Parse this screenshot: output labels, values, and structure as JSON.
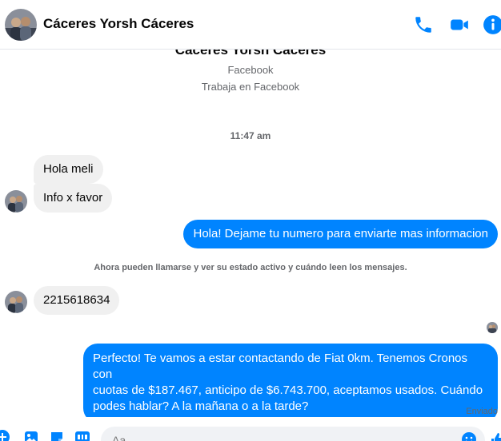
{
  "header": {
    "contact_name": "Cáceres Yorsh Cáceres",
    "icons": [
      "phone-icon",
      "video-icon",
      "info-icon"
    ]
  },
  "profile": {
    "name": "Cáceres Yorsh Cáceres",
    "line1": "Facebook",
    "line2": "Trabaja en Facebook"
  },
  "thread": {
    "timestamp": "11:47 am",
    "notice": "Ahora pueden llamarse y ver su estado activo y cuándo leen los mensajes.",
    "messages": [
      {
        "from": "them",
        "text": "Hola meli"
      },
      {
        "from": "them",
        "text": "Info x favor"
      },
      {
        "from": "me",
        "text": "Hola! Dejame tu numero para enviarte mas informacion"
      },
      {
        "from": "them",
        "text": "2215618634"
      },
      {
        "from": "me",
        "lines": [
          "Perfecto! Te vamos a estar contactando de Fiat 0km. Tenemos Cronos con",
          "cuotas de $187.467, anticipo de $6.743.700, aceptamos usados. Cuándo",
          "podes hablar? A la mañana o a la tarde?"
        ]
      }
    ],
    "status": "Enviado"
  },
  "composer": {
    "placeholder": "Aa"
  },
  "colors": {
    "accent": "#0084ff",
    "incoming_bubble": "#f0f0f0",
    "secondary_text": "#65676b"
  }
}
